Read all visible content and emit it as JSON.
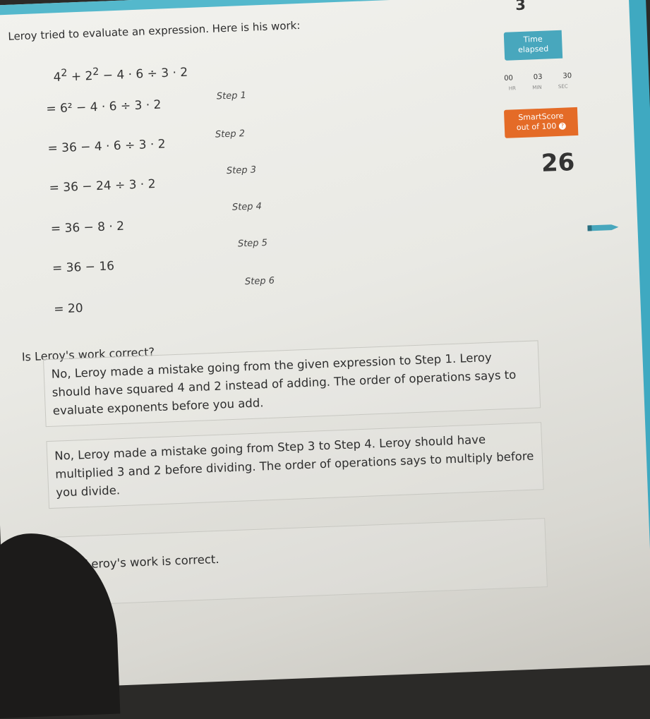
{
  "question_number": "3",
  "intro": "Leroy tried to evaluate an expression. Here is his work:",
  "expression": {
    "a": "4",
    "b": "2",
    "rest": " − 4 · 6 ÷ 3 · 2"
  },
  "work": [
    {
      "text": "= 6² − 4 · 6 ÷ 3 · 2",
      "step": "Step 1"
    },
    {
      "text": "= 36 − 4 · 6 ÷ 3 · 2",
      "step": "Step 2"
    },
    {
      "text": "= 36 − 24 ÷ 3 · 2",
      "step": "Step 3"
    },
    {
      "text": "= 36 − 8 · 2",
      "step": "Step 4"
    },
    {
      "text": "= 36 − 16",
      "step": "Step 5"
    },
    {
      "text": "= 20",
      "step": "Step 6"
    }
  ],
  "question": "Is Leroy's work correct?",
  "choices": [
    "No, Leroy made a mistake going from the given expression to Step 1. Leroy should have squared 4 and 2 instead of adding. The order of operations says to evaluate exponents before you add.",
    "No, Leroy made a mistake going from Step 3 to Step 4. Leroy should have multiplied 3 and 2 before dividing. The order of operations says to multiply before you divide.",
    "Yes, Leroy's work is correct."
  ],
  "sidebar": {
    "time_label": "Time",
    "time_label2": "elapsed",
    "timer": {
      "hr": "00",
      "min": "03",
      "sec": "30"
    },
    "timer_units": {
      "hr": "HR",
      "min": "MIN",
      "sec": "SEC"
    },
    "smartscore_label": "SmartScore",
    "smartscore_sub": "out of 100",
    "score": "26"
  },
  "colors": {
    "accent_blue": "#48a7bd",
    "accent_orange": "#e46b27"
  }
}
